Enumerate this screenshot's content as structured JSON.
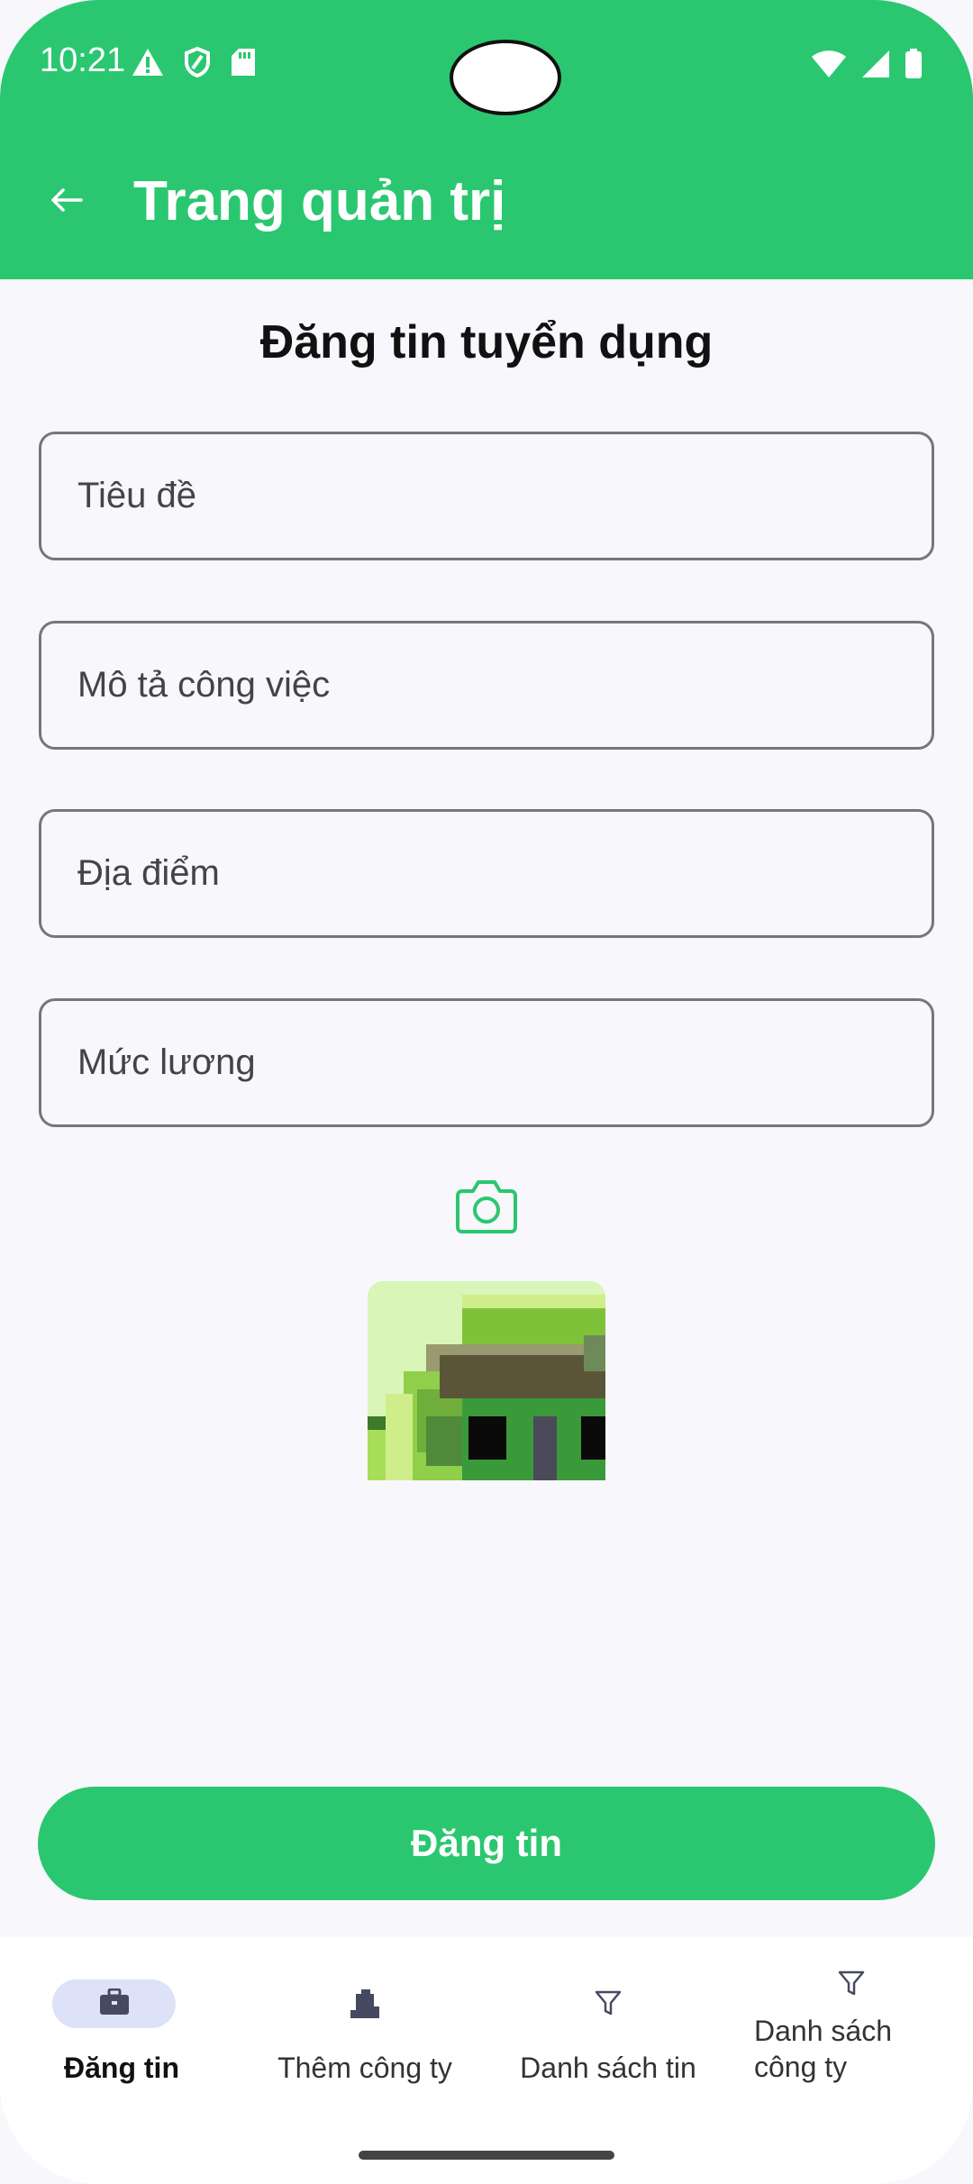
{
  "status_bar": {
    "time": "10:21",
    "left_icons": [
      "warning-icon",
      "shield-icon",
      "sd-card-icon"
    ],
    "right_icons": [
      "wifi-icon",
      "signal-icon",
      "battery-icon"
    ]
  },
  "app_bar": {
    "title": "Trang quản trị",
    "back_icon": "arrow-left-icon"
  },
  "form": {
    "heading": "Đăng tin tuyển dụng",
    "fields": [
      {
        "placeholder": "Tiêu đề",
        "value": ""
      },
      {
        "placeholder": "Mô tả công việc",
        "value": ""
      },
      {
        "placeholder": "Địa điểm",
        "value": ""
      },
      {
        "placeholder": "Mức lương",
        "value": ""
      }
    ],
    "camera_icon": "camera-icon",
    "submit_label": "Đăng tin"
  },
  "bottom_nav": {
    "items": [
      {
        "label": "Đăng tin",
        "icon": "briefcase-icon",
        "active": true
      },
      {
        "label": "Thêm công ty",
        "icon": "building-icon",
        "active": false
      },
      {
        "label": "Danh sách tin",
        "icon": "filter-icon",
        "active": false
      },
      {
        "label": "Danh sách công ty",
        "icon": "filter-icon",
        "active": false
      }
    ]
  },
  "colors": {
    "primary": "#2bc770",
    "background": "#f7f7fc",
    "nav_active_pill": "#dde2f8"
  }
}
